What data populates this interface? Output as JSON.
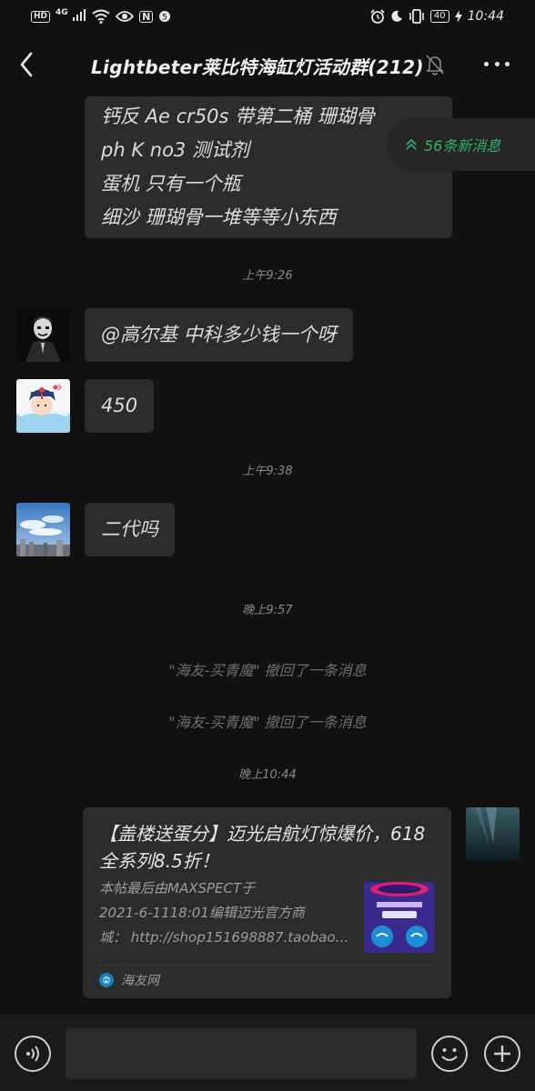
{
  "status_bar": {
    "hd": "HD",
    "network": "4G",
    "nfc": "N",
    "battery": "40",
    "time": "10:44"
  },
  "header": {
    "title": "Lightbeter莱比特海缸灯活动群(212)"
  },
  "new_messages": {
    "label": "56条新消息"
  },
  "messages": {
    "top_bubble": {
      "lines": [
        "钙反 Ae cr50s 带第二桶 珊瑚骨",
        " ph K no3 测试剂",
        "蛋机 只有一个瓶",
        "细沙 珊瑚骨一堆等等小东西"
      ]
    },
    "time_1": "上午9:26",
    "msg_1": "@高尔基  中科多少钱一个呀",
    "msg_2": "450",
    "time_2": "上午9:38",
    "msg_3": "二代吗",
    "time_3": "晚上9:57",
    "recall_1": "\"海友-买青魔\" 撤回了一条消息",
    "recall_2": "\"海友-买青魔\" 撤回了一条消息",
    "time_4": "晚上10:44"
  },
  "link_card": {
    "title": "【盖楼送蛋分】迈光启航灯惊爆价，618全系列8.5折！",
    "desc_1": "本帖最后由MAXSPECT于",
    "desc_2": "2021-6-1118:01编辑迈光官方商",
    "desc_3": "城：  http://shop151698887.taobao…",
    "source": "海友网"
  },
  "colors": {
    "background": "#111111",
    "bubble": "#2c2c2c",
    "accent_green": "#2fb36a"
  }
}
